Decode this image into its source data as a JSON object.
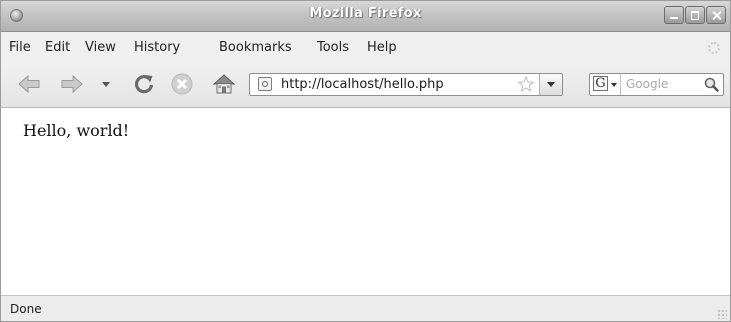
{
  "window": {
    "title": "Mozilla Firefox"
  },
  "menubar": {
    "items": [
      {
        "label": "File"
      },
      {
        "label": "Edit"
      },
      {
        "label": "View"
      },
      {
        "label": "History"
      },
      {
        "label": "Bookmarks"
      },
      {
        "label": "Tools"
      },
      {
        "label": "Help"
      }
    ]
  },
  "toolbar": {
    "icons": {
      "back": "back-arrow-icon",
      "forward": "forward-arrow-icon",
      "history_dropdown": "chevron-down-icon",
      "reload": "reload-icon",
      "stop": "stop-icon",
      "home": "home-icon"
    }
  },
  "address_bar": {
    "url": "http://localhost/hello.php"
  },
  "search_bar": {
    "engine_letter": "G",
    "placeholder": "Google"
  },
  "content": {
    "text": "Hello, world!"
  },
  "status_bar": {
    "text": "Done"
  }
}
